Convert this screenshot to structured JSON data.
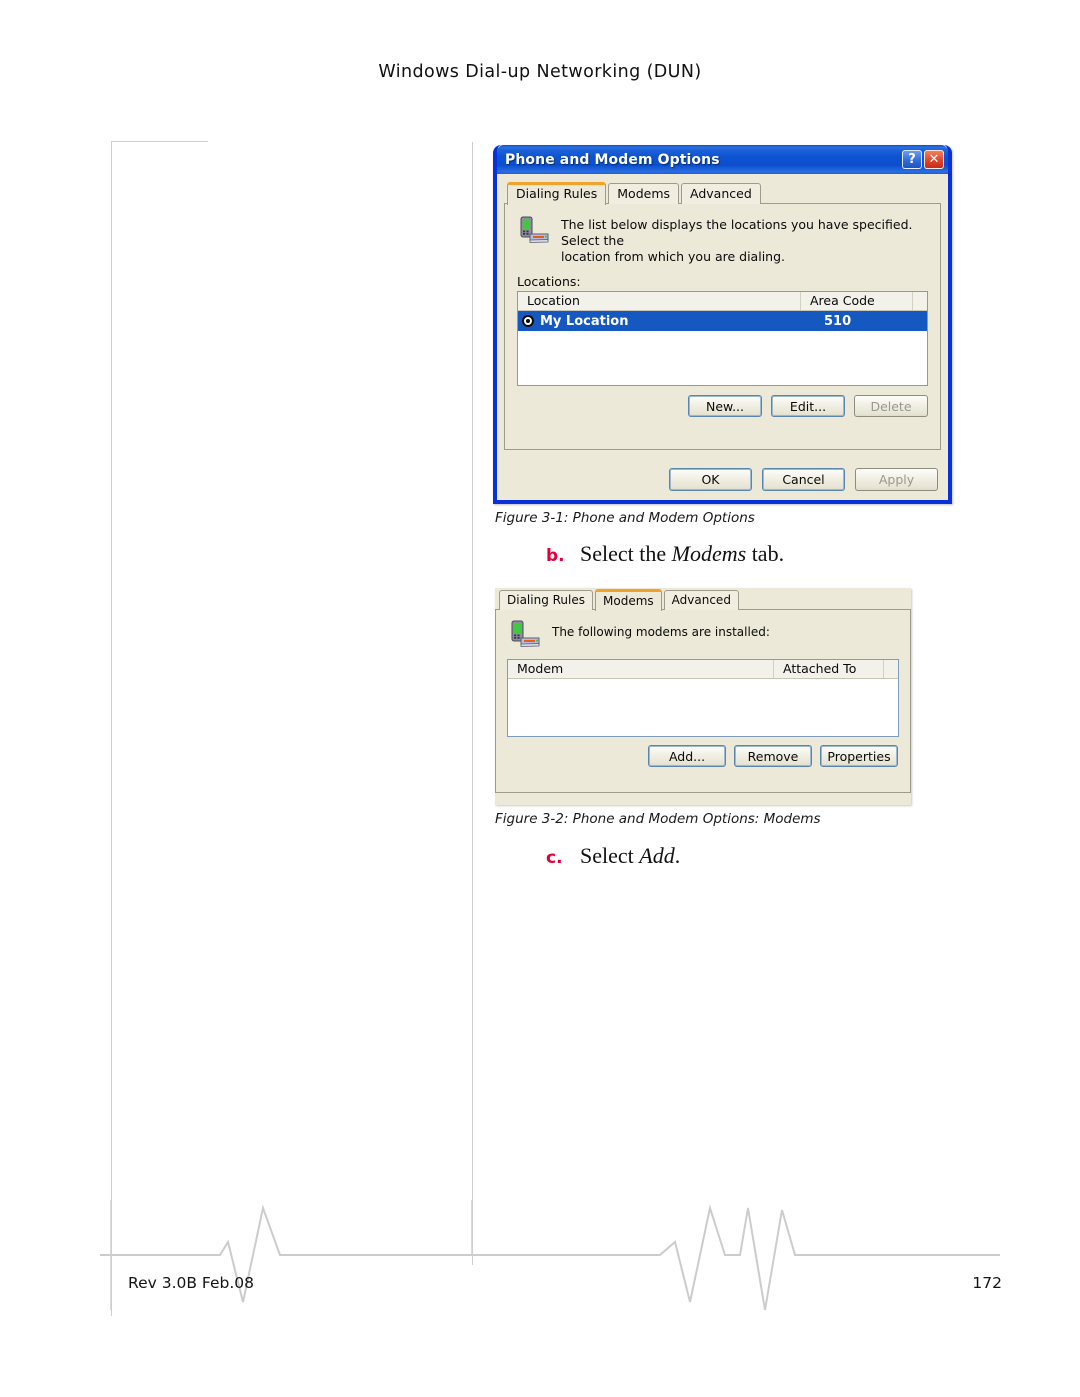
{
  "page": {
    "header_title": "Windows Dial-up Networking (DUN)",
    "footer_left": "Rev 3.0B Feb.08",
    "footer_page": "172"
  },
  "figure1": {
    "caption": "Figure 3-1:  Phone and Modem Options",
    "window_title": "Phone and Modem Options",
    "titlebar_buttons": [
      {
        "name": "help-icon",
        "glyph": "?"
      },
      {
        "name": "close-icon",
        "glyph": "✕"
      }
    ],
    "tabs": [
      {
        "label": "Dialing Rules",
        "active": true
      },
      {
        "label": "Modems",
        "active": false
      },
      {
        "label": "Advanced",
        "active": false
      }
    ],
    "info_text_line1": "The list below displays the locations you have specified. Select the",
    "info_text_line2": "location from which you are dialing.",
    "locations_label": "Locations:",
    "list_columns": [
      "Location",
      "Area Code"
    ],
    "list_rows": [
      {
        "location": "My Location",
        "area_code": "510",
        "selected": true
      }
    ],
    "list_buttons": [
      {
        "label": "New...",
        "disabled": false,
        "default": true
      },
      {
        "label": "Edit...",
        "disabled": false,
        "default": true
      },
      {
        "label": "Delete",
        "disabled": true,
        "default": false
      }
    ],
    "footer_buttons": [
      {
        "label": "OK",
        "disabled": false,
        "default": true
      },
      {
        "label": "Cancel",
        "disabled": false,
        "default": true
      },
      {
        "label": "Apply",
        "disabled": true,
        "default": false
      }
    ]
  },
  "step_b": {
    "marker": "b.",
    "text_before": "Select the ",
    "emphasis": "Modems",
    "text_after": " tab."
  },
  "figure2": {
    "caption": "Figure 3-2:  Phone and Modem Options: Modems",
    "tabs": [
      {
        "label": "Dialing Rules",
        "active": false
      },
      {
        "label": "Modems",
        "active": true
      },
      {
        "label": "Advanced",
        "active": false
      }
    ],
    "info_text": "The following modems are  installed:",
    "list_columns": [
      "Modem",
      "Attached To"
    ],
    "list_rows": [],
    "list_buttons": [
      {
        "label": "Add...",
        "disabled": false,
        "default": true
      },
      {
        "label": "Remove",
        "disabled": false,
        "default": true
      },
      {
        "label": "Properties",
        "disabled": false,
        "default": true
      }
    ]
  },
  "step_c": {
    "marker": "c.",
    "text_before": "Select ",
    "emphasis": "Add",
    "text_after": "."
  },
  "colors": {
    "accent_orange": "#f2a12a",
    "titlebar_blue": "#0d53d2",
    "selection_blue": "#1558c0",
    "dialog_face": "#ece9d8",
    "step_marker_red": "#e2003c"
  }
}
